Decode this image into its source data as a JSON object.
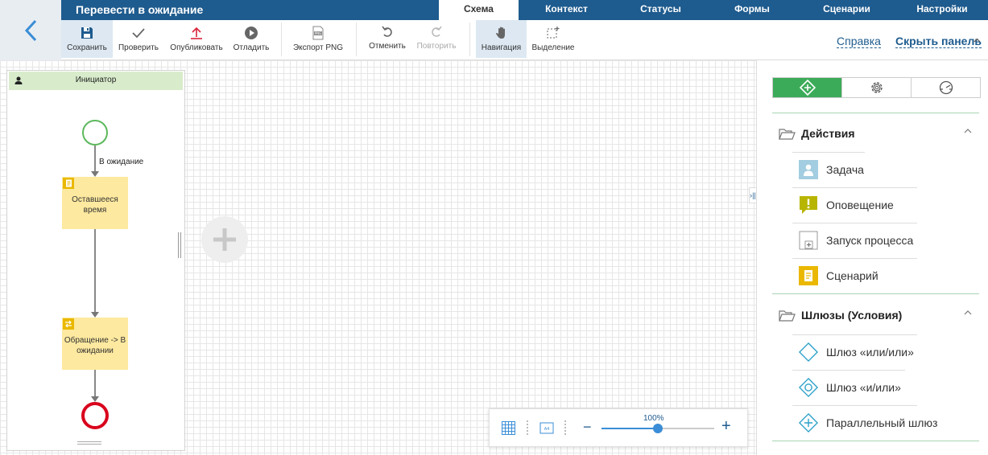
{
  "header": {
    "title": "Перевести в ожидание",
    "tabs": [
      {
        "label": "Схема",
        "active": true
      },
      {
        "label": "Контекст"
      },
      {
        "label": "Статусы"
      },
      {
        "label": "Формы"
      },
      {
        "label": "Сценарии"
      },
      {
        "label": "Настройки"
      }
    ]
  },
  "toolbar": {
    "save": "Сохранить",
    "check": "Проверить",
    "publish": "Опубликовать",
    "debug": "Отладить",
    "export": "Экспорт PNG",
    "undo": "Отменить",
    "redo": "Повторить",
    "navigation": "Навигация",
    "selection": "Выделение",
    "help": "Справка",
    "hide_panel": "Скрыть панель"
  },
  "diagram": {
    "lane_title": "Инициатор",
    "flow_label": "В ожидание",
    "task1": "Оставшееся время",
    "task2": "Обращение -> В ожидании"
  },
  "zoom": {
    "percent_label": "100%",
    "level": 0.5
  },
  "panel": {
    "sections": [
      {
        "name": "Действия",
        "items": [
          "Задача",
          "Оповещение",
          "Запуск процесса",
          "Сценарий"
        ]
      },
      {
        "name": "Шлюзы (Условия)",
        "items": [
          "Шлюз «или/или»",
          "Шлюз «и/или»",
          "Параллельный шлюз"
        ]
      }
    ]
  },
  "colors": {
    "brand": "#1e5b8e",
    "accent_green": "#3cab59",
    "task_fill": "#fde99f",
    "task_badge": "#eab800",
    "start": "#5cb85c",
    "end": "#d9041d",
    "gateway": "#2aa0c8"
  },
  "icons": {
    "back": "chevron-left-icon",
    "save": "floppy-icon",
    "check": "checkmark-icon",
    "publish": "upload-icon",
    "debug": "play-icon",
    "export": "png-file-icon",
    "undo": "undo-icon",
    "redo": "redo-icon",
    "navigation": "hand-icon",
    "selection": "selection-icon"
  }
}
